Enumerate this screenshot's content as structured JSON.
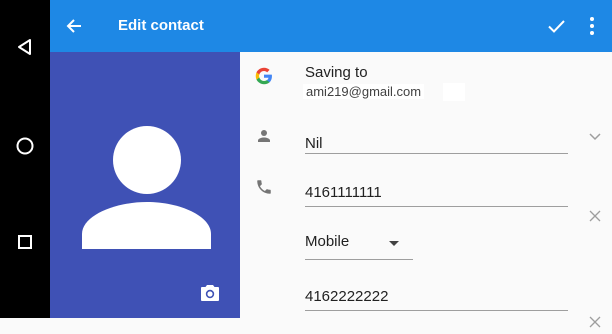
{
  "header": {
    "title": "Edit contact"
  },
  "account": {
    "label": "Saving to",
    "email": "ami219@gmail.com"
  },
  "name_field": {
    "value": "Nil"
  },
  "phones": [
    {
      "number": "4161111111",
      "type": "Mobile"
    },
    {
      "number": "4162222222"
    }
  ],
  "colors": {
    "app_bar": "#1e88e5",
    "photo_background": "#3f51b5",
    "nav_bar": "#000000"
  },
  "icons": {
    "back": "arrow-back-icon",
    "save": "check-icon",
    "more": "more-vert-icon",
    "account": "google-g-icon",
    "name": "person-icon",
    "phone": "phone-icon",
    "camera": "camera-icon",
    "remove": "close-icon",
    "expand": "chevron-down-icon",
    "dropdown": "dropdown-arrow-icon"
  }
}
